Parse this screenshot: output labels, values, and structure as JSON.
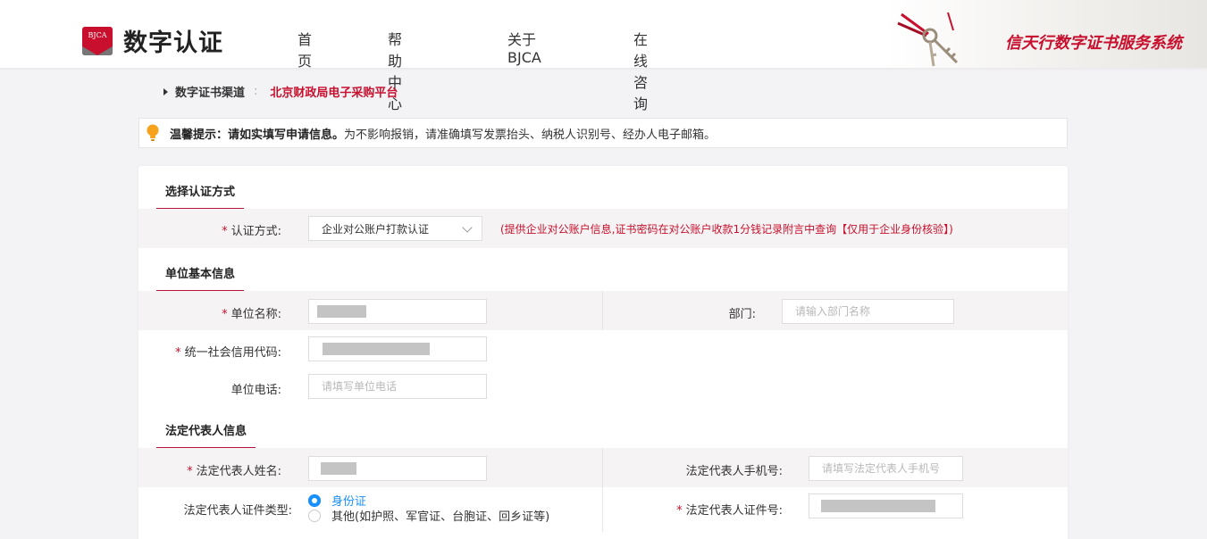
{
  "header": {
    "logo_badge": "BJCA",
    "logo_text": "数字认证",
    "nav": [
      "首页",
      "帮助中心",
      "关于BJCA",
      "在线咨询"
    ],
    "banner_title": "信天行数字证书服务系统"
  },
  "breadcrumb": {
    "label": "数字证书渠道",
    "separator": ":",
    "value": "北京财政局电子采购平台"
  },
  "tip": {
    "strong": "温馨提示：请如实填写申请信息。",
    "text": "为不影响报销，请准确填写发票抬头、纳税人识别号、经办人电子邮箱。"
  },
  "sections": {
    "auth": {
      "title": "选择认证方式",
      "method_label": "认证方式:",
      "method_value": "企业对公账户打款认证",
      "method_hint": "(提供企业对公账户信息,证书密码在对公账户收款1分钱记录附言中查询【仅用于企业身份核验】)"
    },
    "org": {
      "title": "单位基本信息",
      "name_label": "单位名称:",
      "dept_label": "部门:",
      "dept_placeholder": "请输入部门名称",
      "credit_label": "统一社会信用代码:",
      "phone_label": "单位电话:",
      "phone_placeholder": "请填写单位电话"
    },
    "legal": {
      "title": "法定代表人信息",
      "name_label": "法定代表人姓名:",
      "mobile_label": "法定代表人手机号:",
      "mobile_placeholder": "请填写法定代表人手机号",
      "idtype_label": "法定代表人证件类型:",
      "idtype_options": [
        "身份证",
        "其他(如护照、军官证、台胞证、回乡证等)"
      ],
      "idno_label": "法定代表人证件号:"
    }
  },
  "colors": {
    "brand_red": "#c8102e",
    "accent_blue": "#1890ff"
  }
}
